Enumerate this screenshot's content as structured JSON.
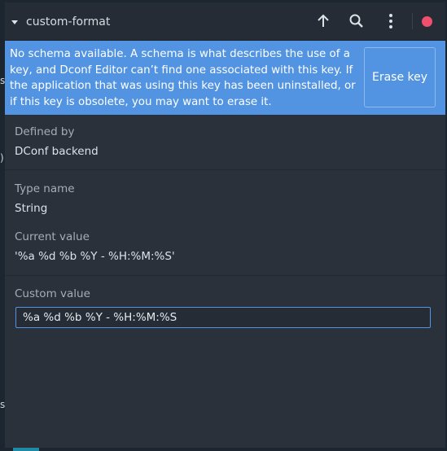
{
  "header": {
    "title": "custom-format",
    "buttons": {
      "up": "arrow-up-icon",
      "search": "search-icon",
      "menu": "kebab-menu-icon",
      "close": "close-icon"
    }
  },
  "infobar": {
    "message": "No schema available. A schema is what describes the use of a key, and Dconf Editor can’t find one associated with this key. If the application that was using this key has been uninstalled, or if this key is obsolete, you may want to erase it.",
    "action_label": "Erase key"
  },
  "details": {
    "defined_by_label": "Defined by",
    "defined_by_value": "DConf backend",
    "type_name_label": "Type name",
    "type_name_value": "String",
    "current_value_label": "Current value",
    "current_value_value": "'%a %d %b %Y - %H:%M:%S'",
    "custom_value_label": "Custom value",
    "custom_value_input": "%a %d %b %Y - %H:%M:%S"
  },
  "colors": {
    "accent": "#5294e2",
    "close": "#f0506e",
    "window_bg": "#2a313b"
  }
}
